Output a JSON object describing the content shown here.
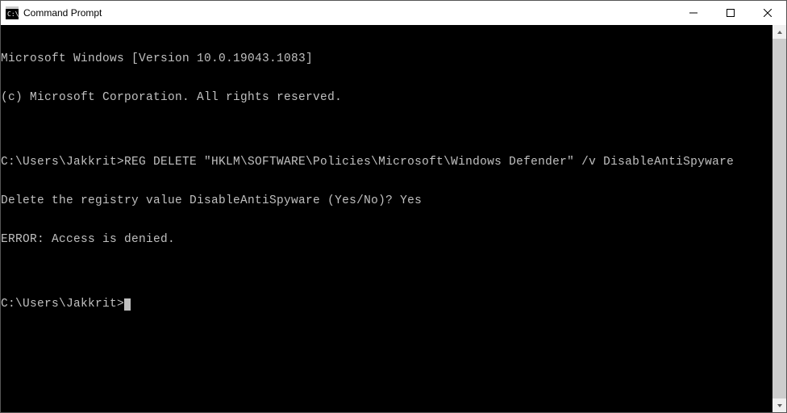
{
  "window": {
    "title": "Command Prompt"
  },
  "terminal": {
    "lines": [
      "Microsoft Windows [Version 10.0.19043.1083]",
      "(c) Microsoft Corporation. All rights reserved.",
      "",
      "C:\\Users\\Jakkrit>REG DELETE \"HKLM\\SOFTWARE\\Policies\\Microsoft\\Windows Defender\" /v DisableAntiSpyware",
      "Delete the registry value DisableAntiSpyware (Yes/No)? Yes",
      "ERROR: Access is denied.",
      "",
      "C:\\Users\\Jakkrit>"
    ]
  }
}
